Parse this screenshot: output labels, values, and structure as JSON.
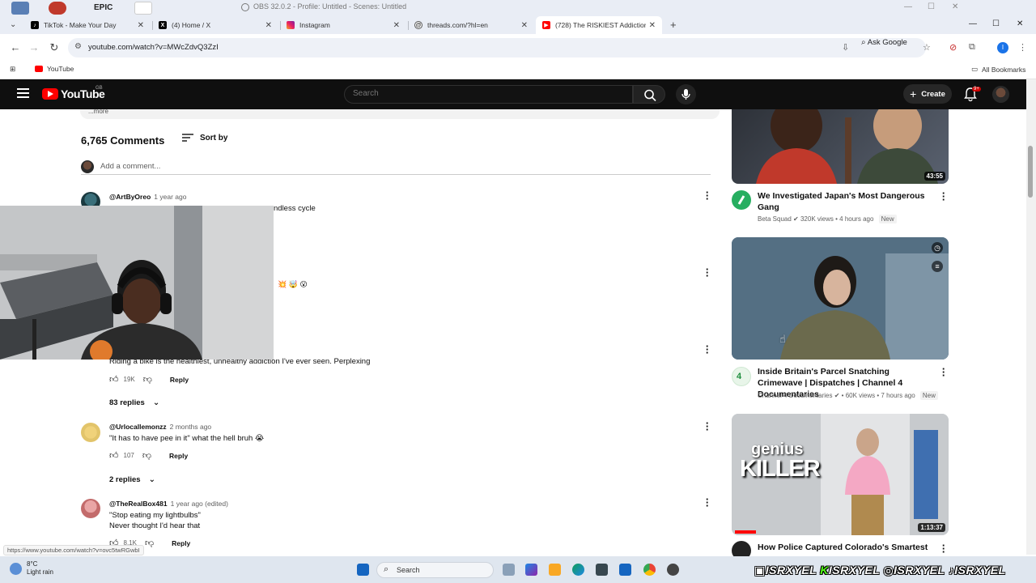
{
  "os_window": {
    "title": "OBS 32.0.2 - Profile: Untitled - Scenes: Untitled",
    "desktop_icon_label": "EPIC"
  },
  "browser": {
    "tabs": [
      {
        "label": "TikTok - Make Your Day",
        "icon": "tiktok-icon",
        "active": false
      },
      {
        "label": "(4) Home / X",
        "icon": "x-icon",
        "active": false
      },
      {
        "label": "Instagram",
        "icon": "instagram-icon",
        "active": false
      },
      {
        "label": "threads.com/?hl=en",
        "icon": "threads-icon",
        "active": false
      },
      {
        "label": "(728) The RISKIEST Addictions |",
        "icon": "youtube-icon",
        "active": true
      }
    ],
    "url": "youtube.com/watch?v=MWcZdvQ3ZzI",
    "ask_google_label": "Ask Google",
    "bookmarks": {
      "items": [
        {
          "label": "YouTube",
          "icon": "youtube-icon"
        }
      ],
      "all_bookmarks_label": "All Bookmarks"
    }
  },
  "youtube": {
    "logo_text": "YouTube",
    "country_code": "GB",
    "search_placeholder": "Search",
    "create_label": "Create",
    "notifications_badge": "9+",
    "description_tail": "...more"
  },
  "comments": {
    "count_label": "6,765 Comments",
    "sort_label": "Sort by",
    "add_comment_placeholder": "Add a comment...",
    "items": [
      {
        "author": "@ArtByOreo",
        "time": "1 year ago",
        "text": "ndless cycle",
        "avatar_color": "#3a6f7a"
      },
      {
        "author": "",
        "time": "",
        "text": "💥 🤯 😮",
        "avatar_color": ""
      },
      {
        "author": "",
        "time": "",
        "text": "Riding a bike is the healthiest, unhealthy addiction I've ever seen. Perplexing",
        "likes": "19K",
        "reply_label": "Reply",
        "replies_label": "83 replies"
      },
      {
        "author": "@Urlocallemonzz",
        "time": "2 months ago",
        "text": "\"It has to have pee in it\" what the hell bruh 😭",
        "likes": "107",
        "reply_label": "Reply",
        "replies_label": "2 replies",
        "avatar_color": "#e2c46a"
      },
      {
        "author": "@TheRealBox481",
        "time": "1 year ago (edited)",
        "text_line1": "\"Stop eating my lightbulbs\"",
        "text_line2": "Never thought I'd hear that",
        "likes": "8.1K",
        "reply_label": "Reply",
        "avatar_color": "#c36b6b"
      }
    ]
  },
  "sidebar": {
    "videos": [
      {
        "duration": "43:55",
        "title": "We Investigated Japan's Most Dangerous Gang",
        "channel": "Beta Squad",
        "views": "320K views",
        "age": "4 hours ago",
        "badge": "New",
        "verified": true,
        "avatar_color": "#27ae60"
      },
      {
        "duration": "",
        "title": "Inside Britain's Parcel Snatching Crimewave | Dispatches | Channel 4 Documentaries",
        "channel": "Channel 4 Documentaries",
        "views": "60K views",
        "age": "7 hours ago",
        "badge": "New",
        "verified": true,
        "avatar_color": "#1e8e3e"
      },
      {
        "duration": "1:13:37",
        "thumb_text_small": "genius",
        "thumb_text_large": "KILLER",
        "title": "How Police Captured Colorado's Smartest",
        "channel": "",
        "views": "",
        "age": "",
        "badge": "",
        "avatar_color": "#222"
      }
    ]
  },
  "status_bar": {
    "hover_link": "https://www.youtube.com/watch?v=ovc5twRGwbI"
  },
  "taskbar": {
    "temperature": "8°C",
    "weather": "Light rain",
    "search_label": "Search",
    "overlay_handle": "ISRXYEL"
  },
  "colors": {
    "yt_red": "#ff0000",
    "yt_header_bg": "#0f0f0f",
    "browser_chrome": "#e9edf5"
  }
}
